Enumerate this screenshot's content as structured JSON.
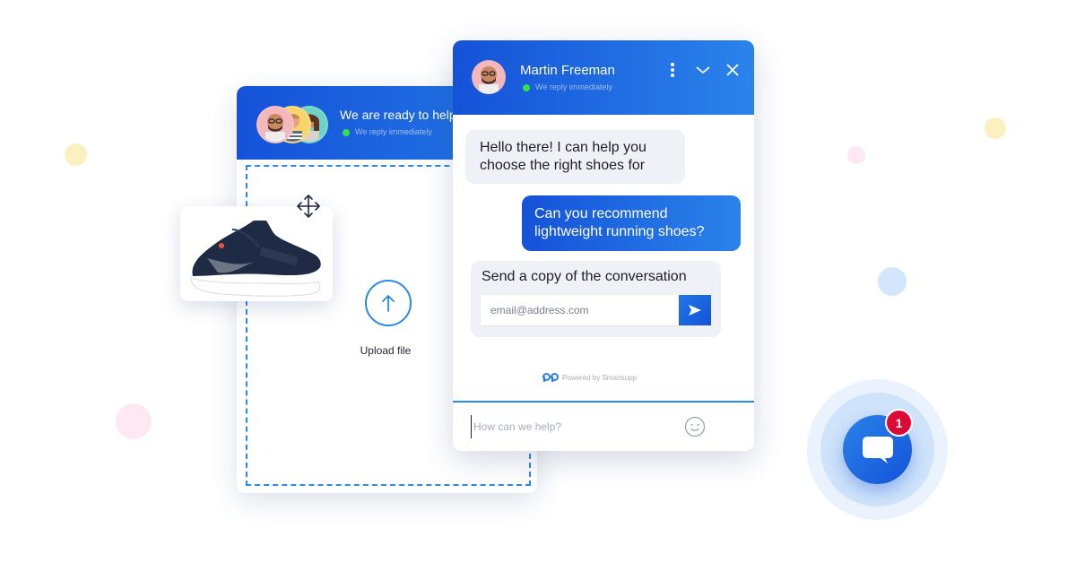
{
  "colors": {
    "brand_blue": "#1552d8",
    "brand_blue_light": "#2a83ea",
    "online": "#35e04a",
    "badge_red": "#dd0a37",
    "bubble_gray": "#f0f1f6"
  },
  "decorations": {
    "dots": [
      "#fbf0c0",
      "#fde8f3",
      "#fbf0c0",
      "#fde8f3",
      "#d3e6fc"
    ]
  },
  "upload_panel": {
    "title": "We are ready to help",
    "status": "We reply immediately",
    "upload_label": "Upload file",
    "icons": [
      "upload-arrow-icon",
      "move-icon"
    ]
  },
  "chat": {
    "agent_name": "Martin Freeman",
    "status": "We reply immediately",
    "header_actions": [
      "more-options-icon",
      "minimize-chevron-icon",
      "close-icon"
    ],
    "messages": [
      {
        "from": "agent",
        "text": "Hello there! I can help you choose the right shoes for"
      },
      {
        "from": "visitor",
        "text": "Can you recommend lightweight running shoes?"
      }
    ],
    "email_card": {
      "title": "Send a copy of the conversation",
      "placeholder": "email@address.com",
      "send_icon": "send-arrow-icon"
    },
    "powered_by": "Powered by Smartsupp",
    "composer_placeholder": "How can we help?",
    "emoji_icon": "smiley-icon"
  },
  "launcher": {
    "icon": "chat-bubble-icon",
    "unread_count": "1"
  }
}
